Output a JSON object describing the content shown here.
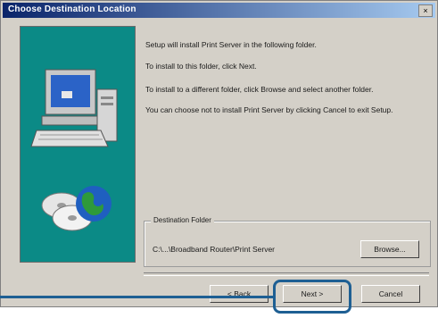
{
  "window": {
    "title": "Choose Destination Location",
    "close_glyph": "×"
  },
  "body_text": [
    "Setup will install Print Server in the following folder.",
    "To install to this folder, click Next.",
    "To install to a different folder, click Browse and select another folder.",
    "You can choose not to install Print Server by clicking Cancel to exit Setup."
  ],
  "destination": {
    "label": "Destination Folder",
    "path": "C:\\...\\Broadband Router\\Print Server",
    "browse_label": "Browse..."
  },
  "buttons": {
    "back": "< Back",
    "next": "Next >",
    "cancel": "Cancel"
  },
  "colors": {
    "art_panel": "#0b8a86",
    "callout": "#1e5f93",
    "title_bar": "#0a246a"
  }
}
